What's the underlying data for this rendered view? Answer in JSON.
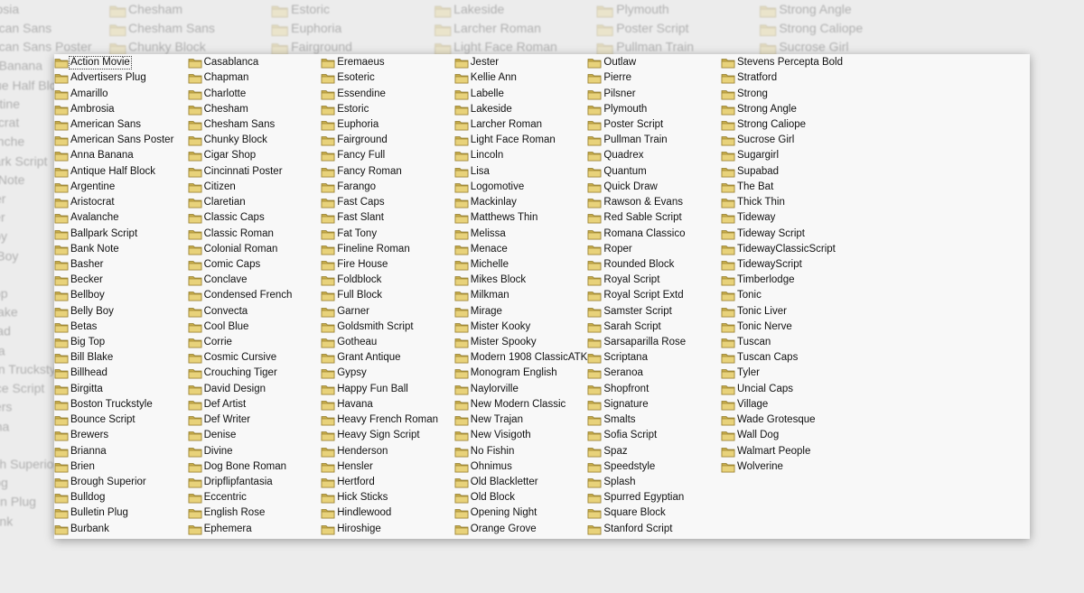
{
  "explorer": {
    "icon": "folder-icon",
    "folder_color": "#e8d27a",
    "focused_item": "Action Movie",
    "columns": [
      [
        "Action Movie",
        "Advertisers Plug",
        "Amarillo",
        "Ambrosia",
        "American Sans",
        "American Sans Poster",
        "Anna Banana",
        "Antique Half Block",
        "Argentine",
        "Aristocrat",
        "Avalanche",
        "Ballpark Script",
        "Bank Note",
        "Basher",
        "Becker",
        "Bellboy",
        "Belly Boy",
        "Betas",
        "Big Top",
        "Bill Blake",
        "Billhead",
        "Birgitta",
        "Boston Truckstyle",
        "Bounce Script",
        "Brewers",
        "Brianna",
        "Brien",
        "Brough Superior",
        "Bulldog",
        "Bulletin Plug",
        "Burbank"
      ],
      [
        "Casablanca",
        "Chapman",
        "Charlotte",
        "Chesham",
        "Chesham Sans",
        "Chunky Block",
        "Cigar Shop",
        "Cincinnati Poster",
        "Citizen",
        "Claretian",
        "Classic Caps",
        "Classic Roman",
        "Colonial Roman",
        "Comic Caps",
        "Conclave",
        "Condensed French",
        "Convecta",
        "Cool Blue",
        "Corrie",
        "Cosmic Cursive",
        "Crouching Tiger",
        "David Design",
        "Def Artist",
        "Def Writer",
        "Denise",
        "Divine",
        "Dog Bone Roman",
        "Dripflipfantasia",
        "Eccentric",
        "English Rose",
        "Ephemera"
      ],
      [
        "Eremaeus",
        "Esoteric",
        "Essendine",
        "Estoric",
        "Euphoria",
        "Fairground",
        "Fancy Full",
        "Fancy Roman",
        "Farango",
        "Fast Caps",
        "Fast Slant",
        "Fat Tony",
        "Fineline Roman",
        "Fire House",
        "Foldblock",
        "Full Block",
        "Garner",
        "Goldsmith Script",
        "Gotheau",
        "Grant Antique",
        "Gypsy",
        "Happy Fun Ball",
        "Havana",
        "Heavy French Roman",
        "Heavy Sign Script",
        "Henderson",
        "Hensler",
        "Hertford",
        "Hick Sticks",
        "Hindlewood",
        "Hiroshige"
      ],
      [
        "Jester",
        "Kellie Ann",
        "Labelle",
        "Lakeside",
        "Larcher Roman",
        "Light Face Roman",
        "Lincoln",
        "Lisa",
        "Logomotive",
        "Mackinlay",
        "Matthews Thin",
        "Melissa",
        "Menace",
        "Michelle",
        "Mikes Block",
        "Milkman",
        "Mirage",
        "Mister Kooky",
        "Mister Spooky",
        "Modern 1908 ClassicATK",
        "Monogram English",
        "Naylorville",
        "New Modern Classic",
        "New Trajan",
        "New Visigoth",
        "No Fishin",
        "Ohnimus",
        "Old Blackletter",
        "Old Block",
        "Opening Night",
        "Orange Grove"
      ],
      [
        "Outlaw",
        "Pierre",
        "Pilsner",
        "Plymouth",
        "Poster Script",
        "Pullman Train",
        "Quadrex",
        "Quantum",
        "Quick Draw",
        "Rawson & Evans",
        "Red Sable Script",
        "Romana Classico",
        "Roper",
        "Rounded Block",
        "Royal Script",
        "Royal Script Extd",
        "Samster Script",
        "Sarah Script",
        "Sarsaparilla Rose",
        "Scriptana",
        "Seranoa",
        "Shopfront",
        "Signature",
        "Smalts",
        "Sofia Script",
        "Spaz",
        "Speedstyle",
        "Splash",
        "Spurred Egyptian",
        "Square Block",
        "Stanford Script"
      ],
      [
        "Stevens Percepta Bold",
        "Stratford",
        "Strong",
        "Strong Angle",
        "Strong Caliope",
        "Sucrose Girl",
        "Sugargirl",
        "Supabad",
        "The Bat",
        "Thick Thin",
        "Tideway",
        "Tideway Script",
        "TidewayClassicScript",
        "TidewayScript",
        "Timberlodge",
        "Tonic",
        "Tonic Liver",
        "Tonic Nerve",
        "Tuscan",
        "Tuscan Caps",
        "Tyler",
        "Uncial Caps",
        "Village",
        "Wade Grotesque",
        "Wall Dog",
        "Walmart People",
        "Wolverine"
      ]
    ]
  }
}
